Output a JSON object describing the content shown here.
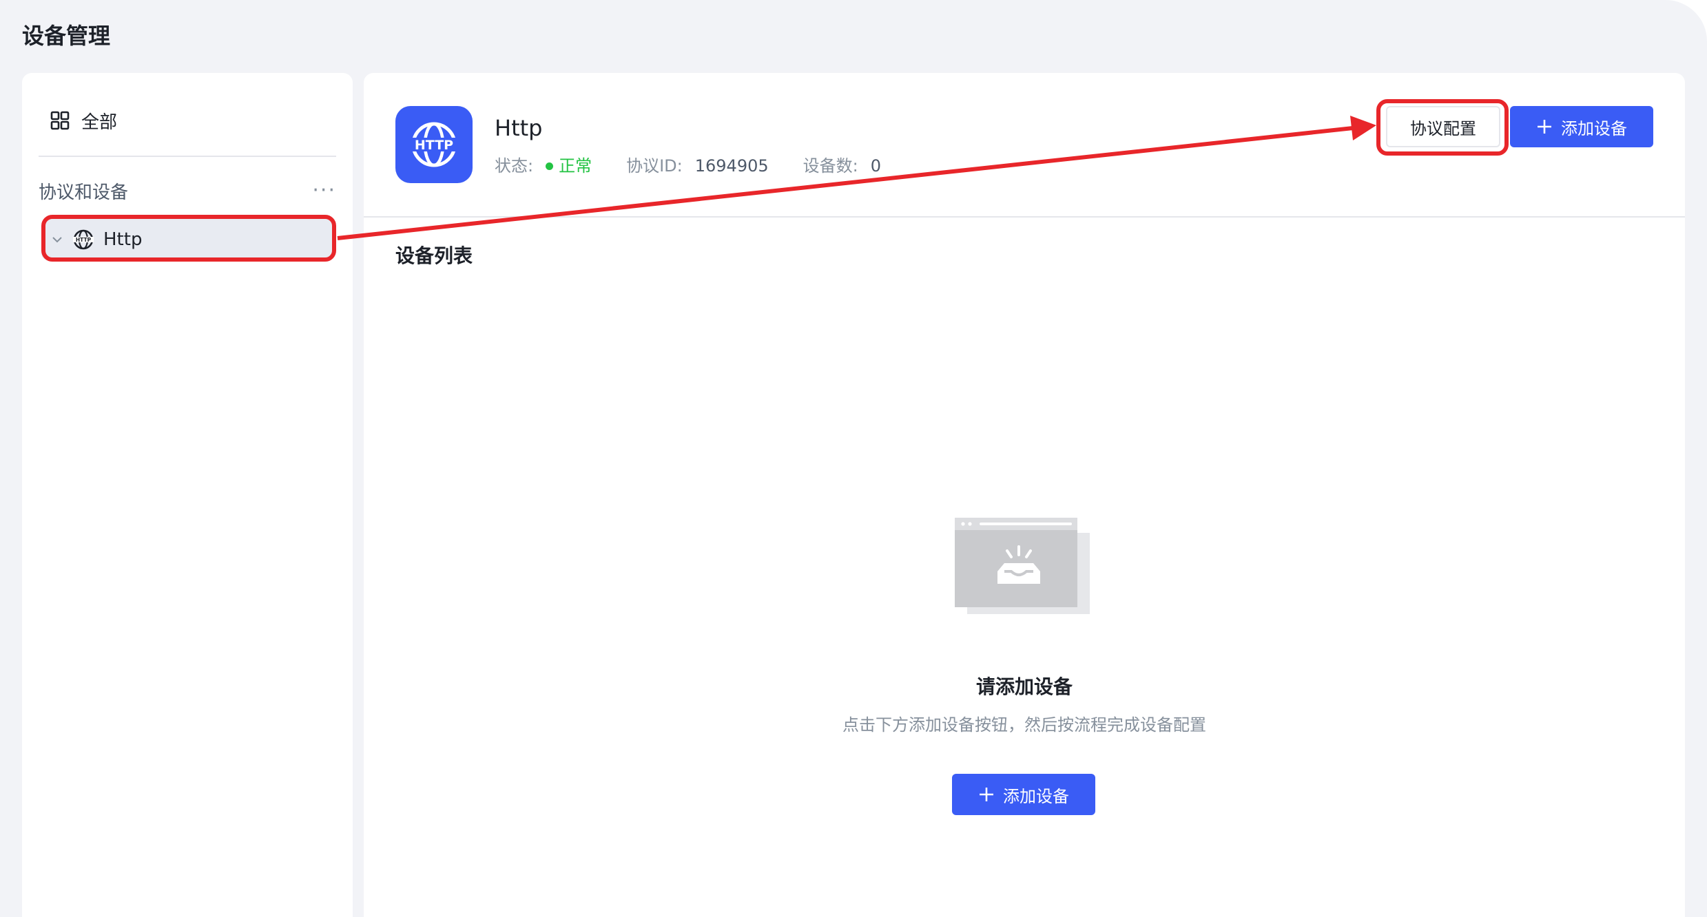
{
  "page": {
    "title": "设备管理"
  },
  "sidebar": {
    "all_label": "全部",
    "section_title": "协议和设备",
    "more_label": "···",
    "tree": [
      {
        "label": "Http",
        "selected": true
      }
    ]
  },
  "protocol": {
    "name": "Http",
    "logo_text": "HTTP",
    "status_label": "状态:",
    "status_value": "正常",
    "id_label": "协议ID:",
    "id_value": "1694905",
    "count_label": "设备数:",
    "count_value": "0"
  },
  "toolbar": {
    "config_label": "协议配置",
    "add_label": "添加设备"
  },
  "device_list": {
    "title": "设备列表",
    "empty_title": "请添加设备",
    "empty_desc": "点击下方添加设备按钮，然后按流程完成设备配置",
    "add_label": "添加设备"
  },
  "colors": {
    "primary": "#3a5cf5",
    "status_ok": "#23c343",
    "annotation": "#e8262a"
  },
  "icons": {
    "nav_all": "grid-icon",
    "more": "more-icon",
    "tree_toggle": "chevron-down-icon",
    "protocol": "globe-icon",
    "add": "plus-icon",
    "empty": "empty-inbox-icon"
  }
}
